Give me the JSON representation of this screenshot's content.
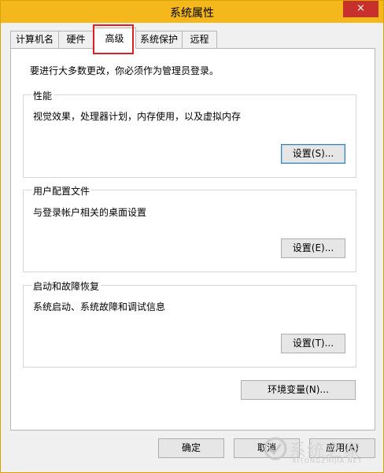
{
  "window": {
    "title": "系统属性",
    "close_symbol": "×"
  },
  "tabs": [
    {
      "label": "计算机名",
      "active": false
    },
    {
      "label": "硬件",
      "active": false
    },
    {
      "label": "高级",
      "active": true
    },
    {
      "label": "系统保护",
      "active": false
    },
    {
      "label": "远程",
      "active": false
    }
  ],
  "highlight_color": "#e02020",
  "admin_note": "要进行大多数更改，你必须作为管理员登录。",
  "groups": {
    "performance": {
      "title": "性能",
      "desc": "视觉效果，处理器计划，内存使用，以及虚拟内存",
      "button": "设置(S)..."
    },
    "profiles": {
      "title": "用户配置文件",
      "desc": "与登录帐户相关的桌面设置",
      "button": "设置(E)..."
    },
    "startup": {
      "title": "启动和故障恢复",
      "desc": "系统启动、系统故障和调试信息",
      "button": "设置(T)..."
    }
  },
  "env_button": "环境变量(N)...",
  "dialog_buttons": {
    "ok": "确定",
    "cancel": "取消",
    "apply": "应用(A)"
  },
  "watermark": {
    "text": "系统之家",
    "sub": "XITONGZHIJIA.NET"
  }
}
